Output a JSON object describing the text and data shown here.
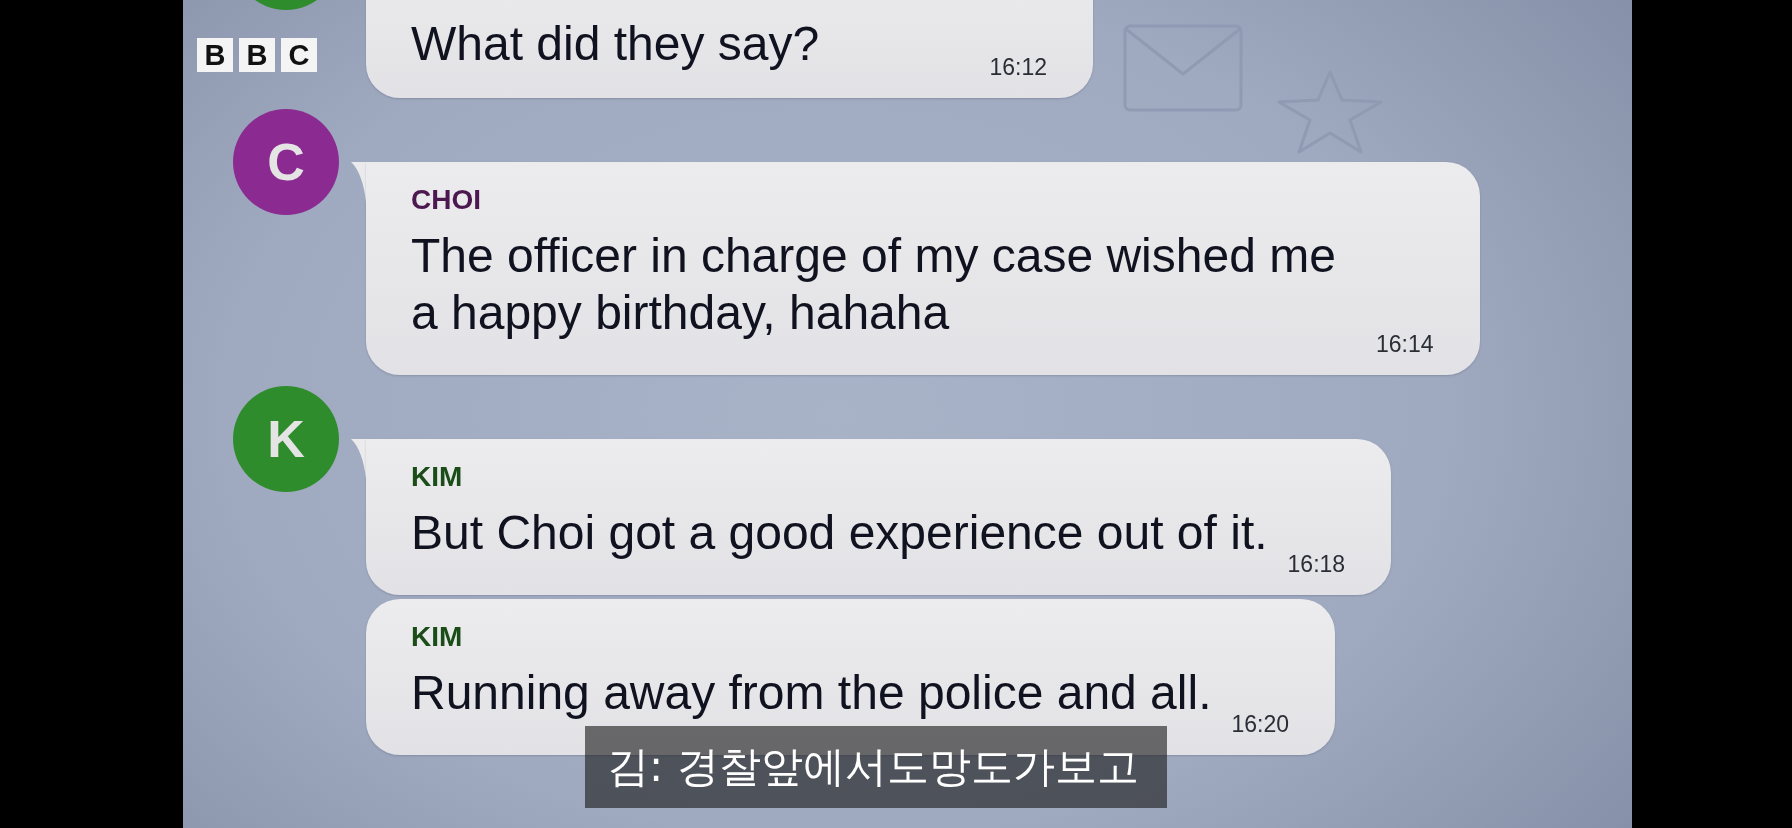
{
  "logo": {
    "letters": [
      "B",
      "B",
      "C"
    ]
  },
  "groups": [
    {
      "color": "#2f8c2c",
      "messages": [
        {
          "text": "What did they say?",
          "time": "16:12"
        }
      ]
    },
    {
      "color": "#8b2b91",
      "avatar_letter": "C",
      "messages": [
        {
          "name": "CHOI",
          "text": "The officer in charge of my case wished me a happy birthday, hahaha",
          "time": "16:14"
        }
      ]
    },
    {
      "color": "#2f8c2c",
      "avatar_letter": "K",
      "messages": [
        {
          "name": "KIM",
          "text": "But Choi got a good experience out of it.",
          "time": "16:18"
        },
        {
          "name": "KIM",
          "text": "Running away from the police and all.",
          "time": "16:20"
        }
      ]
    }
  ],
  "subtitle": {
    "text": "김: 경찰앞에서도망도가보고"
  }
}
